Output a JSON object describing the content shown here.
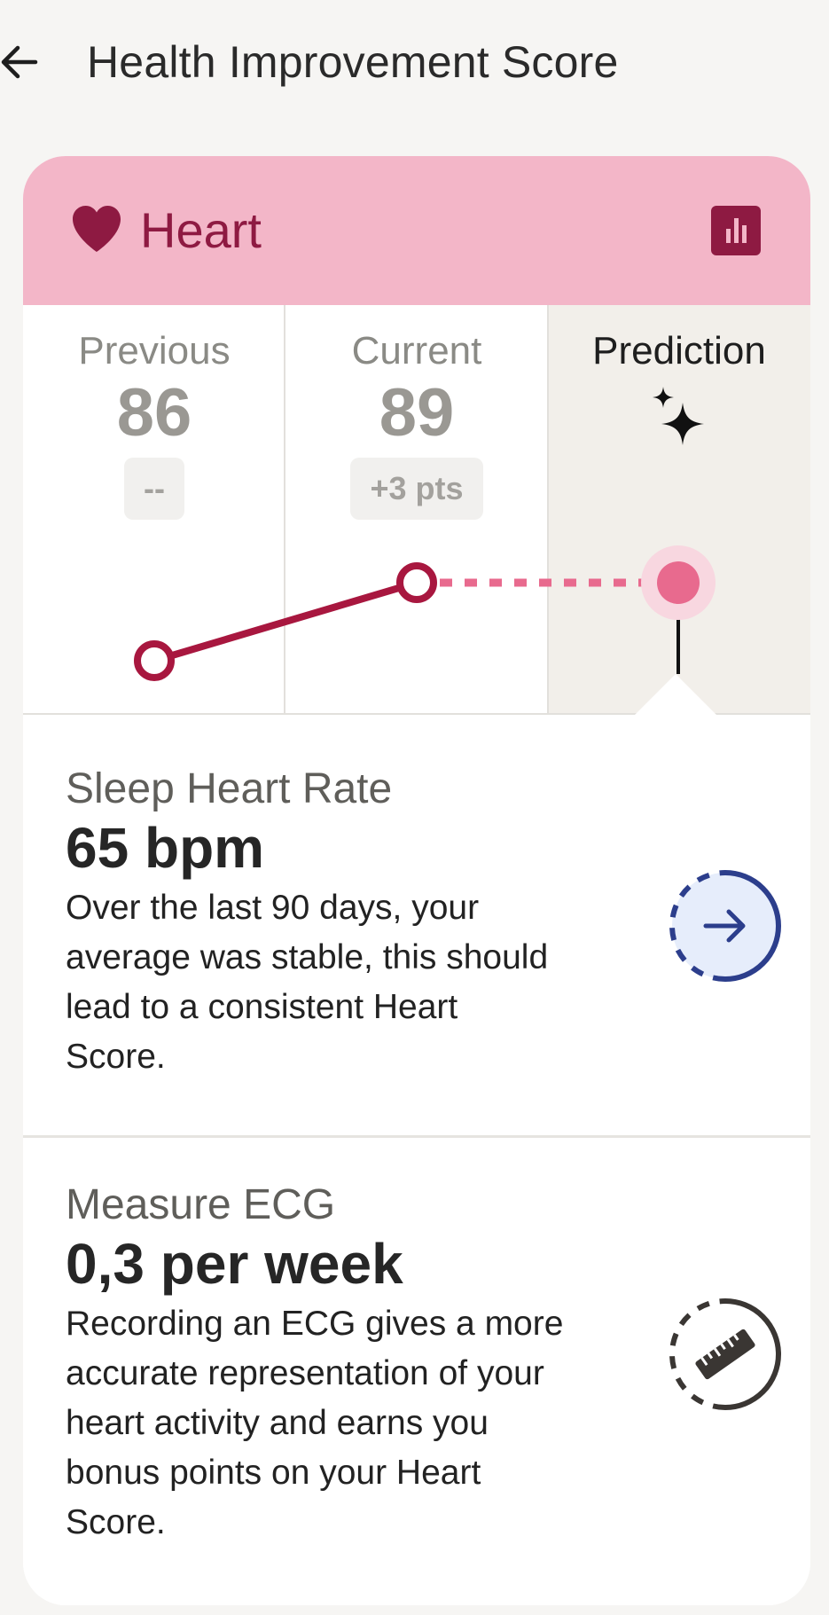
{
  "header": {
    "title": "Health Improvement Score"
  },
  "card": {
    "title": "Heart",
    "accent_color": "#8e1a42",
    "header_color": "#f3b6c8",
    "icons": {
      "title_icon": "heart-icon",
      "chart_button_icon": "bar-chart-icon"
    }
  },
  "scores": {
    "previous": {
      "label": "Previous",
      "value": "86",
      "badge": "--"
    },
    "current": {
      "label": "Current",
      "value": "89",
      "badge": "+3 pts"
    },
    "prediction": {
      "label": "Prediction",
      "icon": "sparkle-icon"
    }
  },
  "chart_data": {
    "type": "line",
    "categories": [
      "Previous",
      "Current",
      "Prediction"
    ],
    "series": [
      {
        "values": [
          86,
          89,
          89
        ]
      }
    ],
    "predicted_segment_style": "dotted",
    "colors": {
      "line": "#a8173f",
      "prediction_point": "#e86a8e"
    }
  },
  "metrics": [
    {
      "label": "Sleep Heart Rate",
      "value": "65 bpm",
      "lines": [
        "Over the last 90 days, your",
        "average was stable, this should",
        "lead to a consistent Heart",
        "Score."
      ],
      "icon": "arrow-right-icon",
      "icon_color": "#2c3e8c"
    },
    {
      "label": "Measure ECG",
      "value": "0,3 per week",
      "lines": [
        "Recording an ECG gives a more",
        "accurate representation of your",
        "heart activity and earns you",
        "bonus points on your Heart",
        "Score."
      ],
      "icon": "ruler-icon",
      "icon_color": "#3a3633"
    }
  ]
}
